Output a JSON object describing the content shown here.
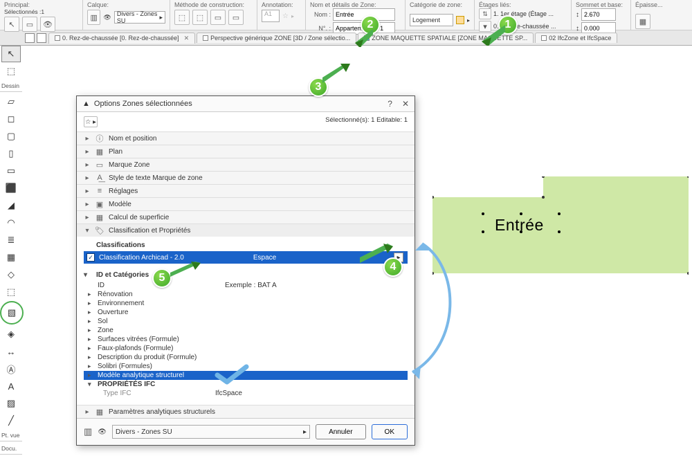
{
  "ribbon": {
    "principal": {
      "label": "Principal:",
      "sub": "Sélectionnés :1"
    },
    "calque": {
      "label": "Calque:",
      "value": "Divers - Zones SU"
    },
    "methode": {
      "label": "Méthode de construction:"
    },
    "annotation": {
      "label": "Annotation:",
      "value": "A1"
    },
    "zone_name": {
      "label": "Nom et détails de Zone:",
      "nom_label": "Nom :",
      "nom_value": "Entrée",
      "num_label": "N°. :",
      "num_value": "Appartement N°1"
    },
    "categorie": {
      "label": "Catégorie de zone:",
      "value": "Logement"
    },
    "etages": {
      "label": "Étages liés:",
      "line1": "1. 1er étage (Étage ...",
      "line2": "0. Rez-de-chaussée ..."
    },
    "sommet": {
      "label": "Sommet et base:",
      "v1": "2.670",
      "v2": "0.000"
    },
    "epaisseur": {
      "label": "Épaisse..."
    }
  },
  "tabs": {
    "t1": "0. Rez-de-chaussée [0. Rez-de-chaussée]",
    "t2": "Perspective générique ZONE [3D / Zone sélectio...",
    "t3": "ZONE MAQUETTE SPATIALE [ZONE MAQUETTE SP...",
    "t4": "02 IfcZone et IfcSpace"
  },
  "left": {
    "dessin": "Dessin",
    "ptvue": "Pt. vue",
    "docu": "Docu."
  },
  "dialog": {
    "title": "Options Zones sélectionnées",
    "sel_info": "Sélectionné(s): 1 Editable: 1",
    "panels": {
      "p1": "Nom et position",
      "p2": "Plan",
      "p3": "Marque Zone",
      "p4": "Style de texte Marque de zone",
      "p5": "Réglages",
      "p6": "Modèle",
      "p7": "Calcul de superficie",
      "p8": "Classification et Propriétés",
      "p9": "Paramètres analytiques structurels"
    },
    "class_section": "Classifications",
    "class_name": "Classification Archicad - 2.0",
    "class_val": "Espace",
    "id_section": "ID et Catégories",
    "rows": {
      "id": "ID",
      "id_ex": "Exemple : BAT A",
      "renov": "Rénovation",
      "env": "Environnement",
      "ouv": "Ouverture",
      "sol": "Sol",
      "zone": "Zone",
      "surf": "Surfaces vitrées (Formule)",
      "faux": "Faux-plafonds (Formule)",
      "desc": "Description du produit (Formule)",
      "solibri": "Solibri (Formules)",
      "modele": "Modèle analytique structurel",
      "propifc": "PROPRIÉTÉS IFC",
      "typeifc_lbl": "Type IFC",
      "typeifc_val": "IfcSpace"
    },
    "footer_layer": "Divers - Zones SU",
    "cancel": "Annuler",
    "ok": "OK"
  },
  "canvas": {
    "zone_text": "Entrée"
  }
}
